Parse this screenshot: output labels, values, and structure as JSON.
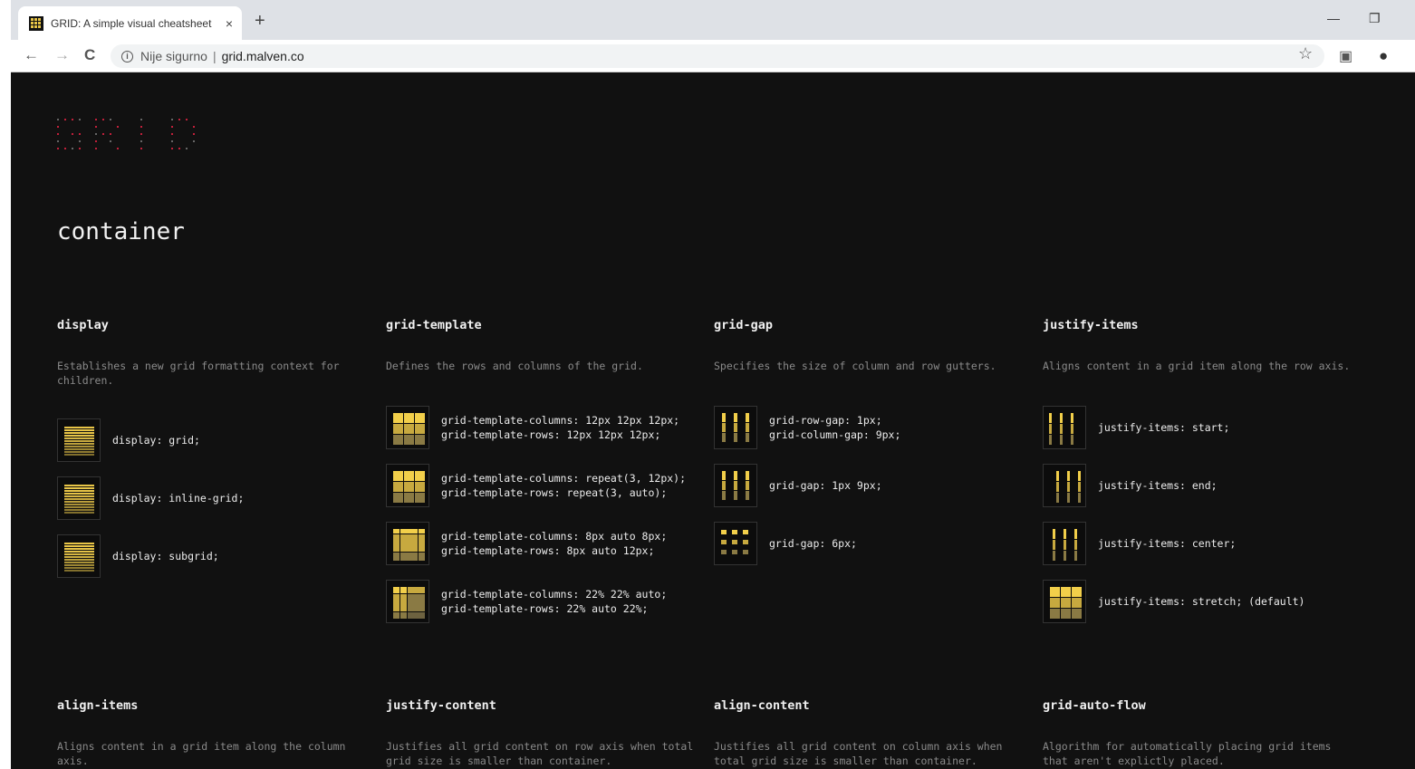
{
  "browser": {
    "tab_title": "GRID: A simple visual cheatsheet",
    "tab_close": "×",
    "new_tab": "+",
    "security_label": "Nije sigurno",
    "separator": "|",
    "url": "grid.malven.co"
  },
  "icons": {
    "back": "←",
    "forward": "→",
    "reload": "C",
    "star": "☆",
    "camera": "▣",
    "account": "●",
    "minimize": "—",
    "restore": "❐",
    "info": "i"
  },
  "colors": {
    "accent": "#e8c547",
    "logo": "#c0203a",
    "background": "#111111"
  },
  "page": {
    "section_title": "container",
    "properties": [
      {
        "name": "display",
        "description": "Establishes a new grid formatting context for children.",
        "examples": [
          "display: grid;",
          "display: inline-grid;",
          "display: subgrid;"
        ]
      },
      {
        "name": "grid-template",
        "description": "Defines the rows and columns of the grid.",
        "examples": [
          "grid-template-columns: 12px 12px 12px;\ngrid-template-rows: 12px 12px 12px;",
          "grid-template-columns: repeat(3, 12px);\ngrid-template-rows: repeat(3, auto);",
          "grid-template-columns: 8px auto 8px;\ngrid-template-rows: 8px auto 12px;",
          "grid-template-columns: 22% 22% auto;\ngrid-template-rows: 22% auto 22%;"
        ]
      },
      {
        "name": "grid-gap",
        "description": "Specifies the size of column and row gutters.",
        "examples": [
          "grid-row-gap: 1px;\ngrid-column-gap: 9px;",
          "grid-gap: 1px 9px;",
          "grid-gap: 6px;"
        ]
      },
      {
        "name": "justify-items",
        "description": "Aligns content in a grid item along the row axis.",
        "examples": [
          "justify-items: start;",
          "justify-items: end;",
          "justify-items: center;",
          "justify-items: stretch; (default)"
        ]
      },
      {
        "name": "align-items",
        "description": "Aligns content in a grid item along the column axis.",
        "examples": []
      },
      {
        "name": "justify-content",
        "description": "Justifies all grid content on row axis when total grid size is smaller than container.",
        "examples": []
      },
      {
        "name": "align-content",
        "description": "Justifies all grid content on column axis when total grid size is smaller than container.",
        "examples": []
      },
      {
        "name": "grid-auto-flow",
        "description": "Algorithm for automatically placing grid items that aren't explictly placed.",
        "examples": []
      }
    ]
  }
}
